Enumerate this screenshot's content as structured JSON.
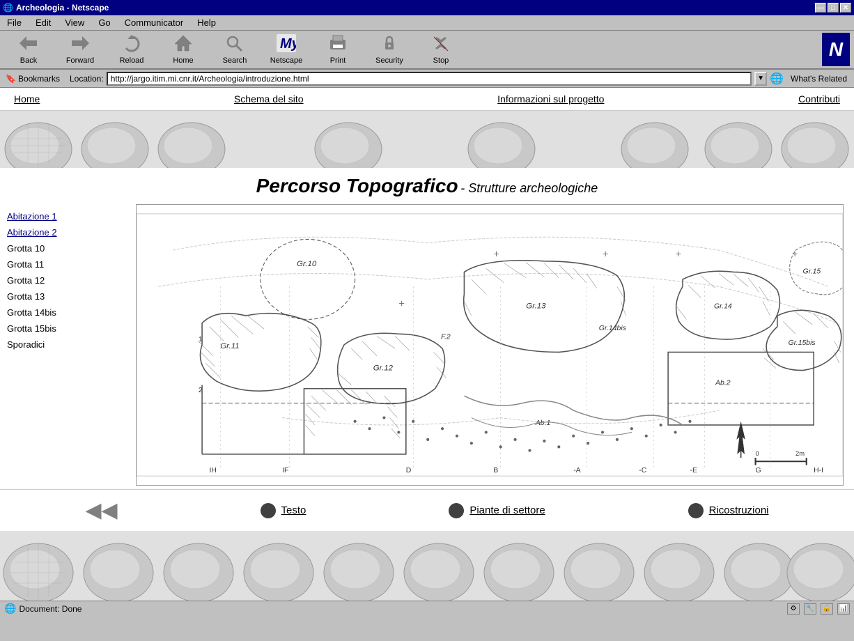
{
  "window": {
    "title": "Archeologia - Netscape",
    "icon": "🌐"
  },
  "titlebar": {
    "minimize": "—",
    "maximize": "□",
    "close": "✕"
  },
  "menubar": {
    "items": [
      "File",
      "Edit",
      "View",
      "Go",
      "Communicator",
      "Help"
    ]
  },
  "toolbar": {
    "buttons": [
      {
        "id": "back",
        "label": "Back",
        "icon": "◀"
      },
      {
        "id": "forward",
        "label": "Forward",
        "icon": "▶"
      },
      {
        "id": "reload",
        "label": "Reload",
        "icon": "↺"
      },
      {
        "id": "home",
        "label": "Home",
        "icon": "🏠"
      },
      {
        "id": "search",
        "label": "Search",
        "icon": "🔍"
      },
      {
        "id": "netscape",
        "label": "Netscape",
        "icon": "N"
      },
      {
        "id": "print",
        "label": "Print",
        "icon": "🖨"
      },
      {
        "id": "security",
        "label": "Security",
        "icon": "🔒"
      },
      {
        "id": "stop",
        "label": "Stop",
        "icon": "⛔"
      }
    ]
  },
  "locationbar": {
    "bookmarks_label": "Bookmarks",
    "location_label": "Location:",
    "url": "http://jargo.itim.mi.cnr.it/Archeologia/introduzione.html",
    "whats_related": "What's Related"
  },
  "nav": {
    "links": [
      "Home",
      "Schema del sito",
      "Informazioni sul progetto",
      "Contributi"
    ]
  },
  "page": {
    "title_main": "Percorso Topografico",
    "title_sub": "- Strutture archeologiche",
    "sidebar_items": [
      {
        "label": "Abitazione 1",
        "link": true
      },
      {
        "label": "Abitazione 2",
        "link": true
      },
      {
        "label": "Grotta 10",
        "link": false
      },
      {
        "label": "Grotta 11",
        "link": false
      },
      {
        "label": "Grotta 12",
        "link": false
      },
      {
        "label": "Grotta 13",
        "link": false
      },
      {
        "label": "Grotta 14bis",
        "link": false
      },
      {
        "label": "Grotta 15bis",
        "link": false
      },
      {
        "label": "Sporadici",
        "link": false
      }
    ],
    "map_labels": [
      "Gr.10",
      "Gr.11",
      "Gr.12",
      "F.2",
      "Gr.13",
      "Gr.14bis",
      "Gr.14",
      "Gr.15bis",
      "Gr.15",
      "Ab.2",
      "Ab.1",
      "IH",
      "IF",
      "D",
      "B",
      "-A",
      "-C",
      "-E",
      "G",
      "H-I",
      "0",
      "2m"
    ],
    "bottom_nav": [
      {
        "label": "Testo",
        "bullet": true
      },
      {
        "label": "Piante di settore",
        "bullet": true
      },
      {
        "label": "Ricostruzioni",
        "bullet": true
      }
    ]
  },
  "statusbar": {
    "text": "Document: Done"
  }
}
